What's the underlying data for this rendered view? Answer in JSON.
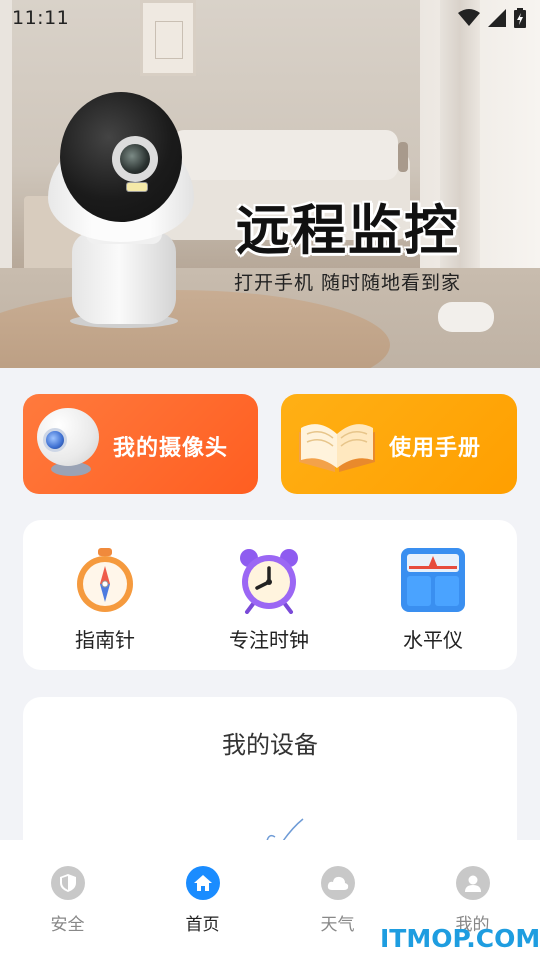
{
  "status_bar": {
    "time": "11:11"
  },
  "hero": {
    "title": "远程监控",
    "subtitle": "打开手机 随时随地看到家"
  },
  "quick_actions": {
    "camera_label": "我的摄像头",
    "manual_label": "使用手册"
  },
  "tools": [
    {
      "label": "指南针",
      "icon": "compass-icon"
    },
    {
      "label": "专注时钟",
      "icon": "alarm-clock-icon"
    },
    {
      "label": "水平仪",
      "icon": "level-icon"
    }
  ],
  "devices": {
    "title": "我的设备"
  },
  "bottom_nav": [
    {
      "label": "安全",
      "icon": "shield-icon",
      "active": false
    },
    {
      "label": "首页",
      "icon": "home-icon",
      "active": true
    },
    {
      "label": "天气",
      "icon": "cloud-icon",
      "active": false
    },
    {
      "label": "我的",
      "icon": "user-icon",
      "active": false
    }
  ],
  "watermark": "ITMOP.COM",
  "colors": {
    "accent_blue": "#1a8cff",
    "camera_card": "#ff6a2b",
    "manual_card": "#ffa50a",
    "background": "#f2f3f7"
  }
}
